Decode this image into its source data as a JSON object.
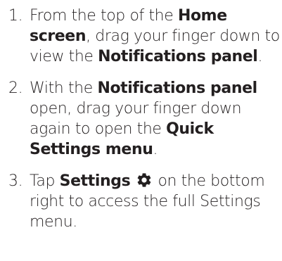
{
  "steps": [
    {
      "number": "1.",
      "t1": "From the top of the ",
      "b1": "Home screen",
      "t2": ", drag your finger down to view the ",
      "b2": "Notifications panel",
      "t3": "."
    },
    {
      "number": "2.",
      "t1": "With the ",
      "b1": "Notifications panel",
      "t2": " open, drag your finger down again to open the ",
      "b2": "Quick Settings menu",
      "t3": "."
    },
    {
      "number": "3.",
      "t1": "Tap ",
      "b1": "Settings",
      "icon": "gear-icon",
      "t2": " on the bottom right to access the full Settings menu."
    }
  ]
}
